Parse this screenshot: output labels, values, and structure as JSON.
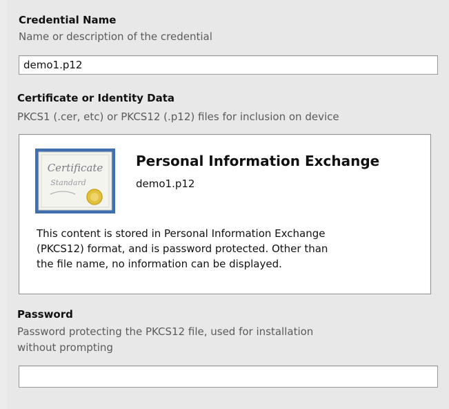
{
  "credential_name": {
    "title": "Credential Name",
    "subtitle": "Name or description of the credential",
    "value": "demo1.p12"
  },
  "certificate": {
    "title": "Certificate or Identity Data",
    "subtitle": "PKCS1 (.cer, etc) or PKCS12 (.p12) files for inclusion on device",
    "icon": "certificate-icon",
    "icon_script_line1": "Certificate",
    "icon_script_line2": "Standard",
    "type_title": "Personal Information Exchange",
    "filename": "demo1.p12",
    "description_lines": [
      "This content is stored in Personal Information Exchange",
      "(PKCS12) format, and is password protected.  Other than",
      "the file name, no information can be displayed."
    ]
  },
  "password": {
    "title": "Password",
    "subtitle_lines": [
      "Password protecting the PKCS12 file, used for installation",
      "without prompting"
    ],
    "value": ""
  },
  "colors": {
    "background": "#ececec",
    "field_border": "#9a9a9a",
    "subtitle_text": "#5b5b5b",
    "icon_blue": "#3f6fae",
    "seal_gold": "#e2c23a"
  }
}
